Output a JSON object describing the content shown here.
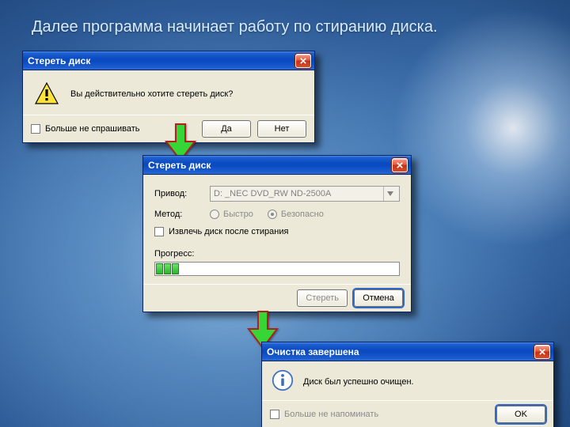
{
  "caption": "Далее программа начинает работу по стиранию диска.",
  "dialog1": {
    "title": "Стереть диск",
    "message": "Вы действительно хотите стереть диск?",
    "dont_ask": "Больше не спрашивать",
    "yes": "Да",
    "no": "Нет"
  },
  "dialog2": {
    "title": "Стереть диск",
    "drive_label": "Привод:",
    "drive_value": "D: _NEC DVD_RW ND-2500A",
    "method_label": "Метод:",
    "method_fast": "Быстро",
    "method_safe": "Безопасно",
    "eject": "Извлечь диск после стирания",
    "progress_label": "Прогресс:",
    "erase_btn": "Стереть",
    "cancel_btn": "Отмена"
  },
  "dialog3": {
    "title": "Очистка завершена",
    "message": "Диск был успешно очищен.",
    "dont_remind": "Больше не напоминать",
    "ok": "OK"
  }
}
